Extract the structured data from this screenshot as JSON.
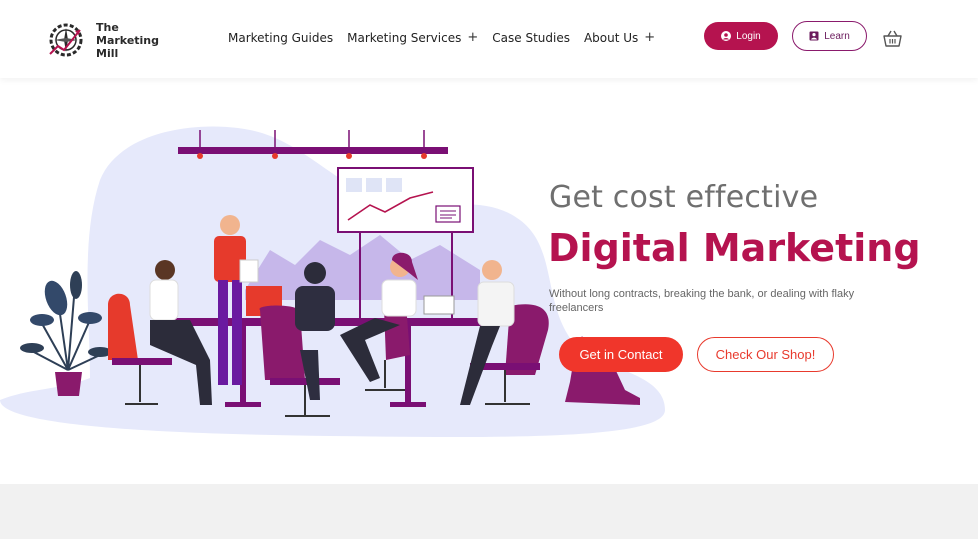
{
  "brand": {
    "name_line1": "The",
    "name_line2": "Marketing",
    "name_line3": "Mill"
  },
  "nav": {
    "items": [
      {
        "label": "Marketing Guides",
        "has_submenu": false
      },
      {
        "label": "Marketing Services",
        "has_submenu": true
      },
      {
        "label": "Case Studies",
        "has_submenu": false
      },
      {
        "label": "About Us",
        "has_submenu": true
      }
    ],
    "submenu_symbol": "+"
  },
  "header": {
    "login_label": "Login",
    "learn_label": "Learn",
    "login_icon": "user-icon",
    "learn_icon": "learner-icon",
    "cart_icon": "basket-icon"
  },
  "hero": {
    "subtitle": "Get cost effective",
    "title": "Digital Marketing",
    "description": "Without long contracts, breaking the bank, or dealing with flaky freelancers",
    "cta_primary": "Get in Contact",
    "cta_secondary": "Check Our Shop!"
  },
  "colors": {
    "brand_magenta": "#b5134f",
    "brand_purple": "#8a1a6c",
    "cta_red": "#f0362b",
    "blob": "#e6e9fb",
    "furniture_purple": "#7a0f74",
    "chair_red": "#e63a2c"
  }
}
